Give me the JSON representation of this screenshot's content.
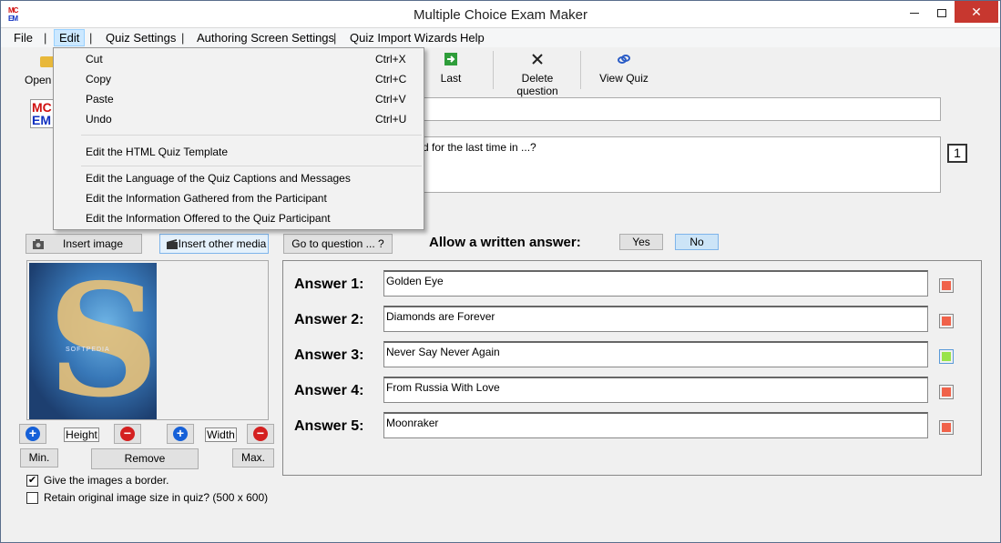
{
  "window": {
    "title": "Multiple Choice Exam Maker",
    "icon_line1": "MC",
    "icon_line2": "EM"
  },
  "menubar": {
    "items": [
      "File",
      "Edit",
      "Quiz Settings",
      "Authoring Screen Settings",
      "Quiz Import Wizards",
      "Help"
    ],
    "separator": "|"
  },
  "toolbar": {
    "open_label": "Open Q",
    "last_label": "Last",
    "delete_label": "Delete question",
    "view_label": "View Quiz"
  },
  "edit_menu": {
    "cut": "Cut",
    "cut_sc": "Ctrl+X",
    "copy": "Copy",
    "copy_sc": "Ctrl+C",
    "paste": "Paste",
    "paste_sc": "Ctrl+V",
    "undo": "Undo",
    "undo_sc": "Ctrl+U",
    "template": "Edit the HTML Quiz Template",
    "language": "Edit the Language of the Quiz Captions and Messages",
    "info_gathered": "Edit the Information Gathered from the Participant",
    "info_offered": "Edit the Information Offered to the Quiz Participant"
  },
  "logo": {
    "line1": "MC",
    "line2": "EM"
  },
  "question": {
    "text_visible": "d for the last time in ...?",
    "number": "1"
  },
  "media": {
    "insert_image": "Insert image",
    "insert_media": "Insert other media",
    "goto_question": "Go to question ... ?",
    "watermark": "SOFTPEDIA",
    "image_letter": "S"
  },
  "written_answer": {
    "label": "Allow a written answer:",
    "yes": "Yes",
    "no": "No"
  },
  "image_controls": {
    "height": "Height",
    "width": "Width",
    "min": "Min.",
    "remove": "Remove",
    "max": "Max.",
    "plus_glyph": "+",
    "minus_glyph": "−"
  },
  "options": {
    "border": "Give the images a border.",
    "border_checked": "✔",
    "retain": "Retain original image size in quiz? (500 x 600)"
  },
  "answers": [
    {
      "label": "Answer 1:",
      "value": "Golden Eye",
      "correct": false
    },
    {
      "label": "Answer 2:",
      "value": "Diamonds are Forever",
      "correct": false
    },
    {
      "label": "Answer 3:",
      "value": "Never Say Never Again",
      "correct": true
    },
    {
      "label": "Answer 4:",
      "value": "From Russia With Love",
      "correct": false
    },
    {
      "label": "Answer 5:",
      "value": "Moonraker",
      "correct": false
    }
  ],
  "colors": {
    "correct": "#99e34a",
    "incorrect": "#f0624a",
    "close": "#c7372f"
  },
  "icons": {
    "folder": "folder-icon",
    "last": "last-icon",
    "delete": "x-icon",
    "view": "link-icon",
    "image": "camera-icon",
    "media": "film-icon"
  }
}
